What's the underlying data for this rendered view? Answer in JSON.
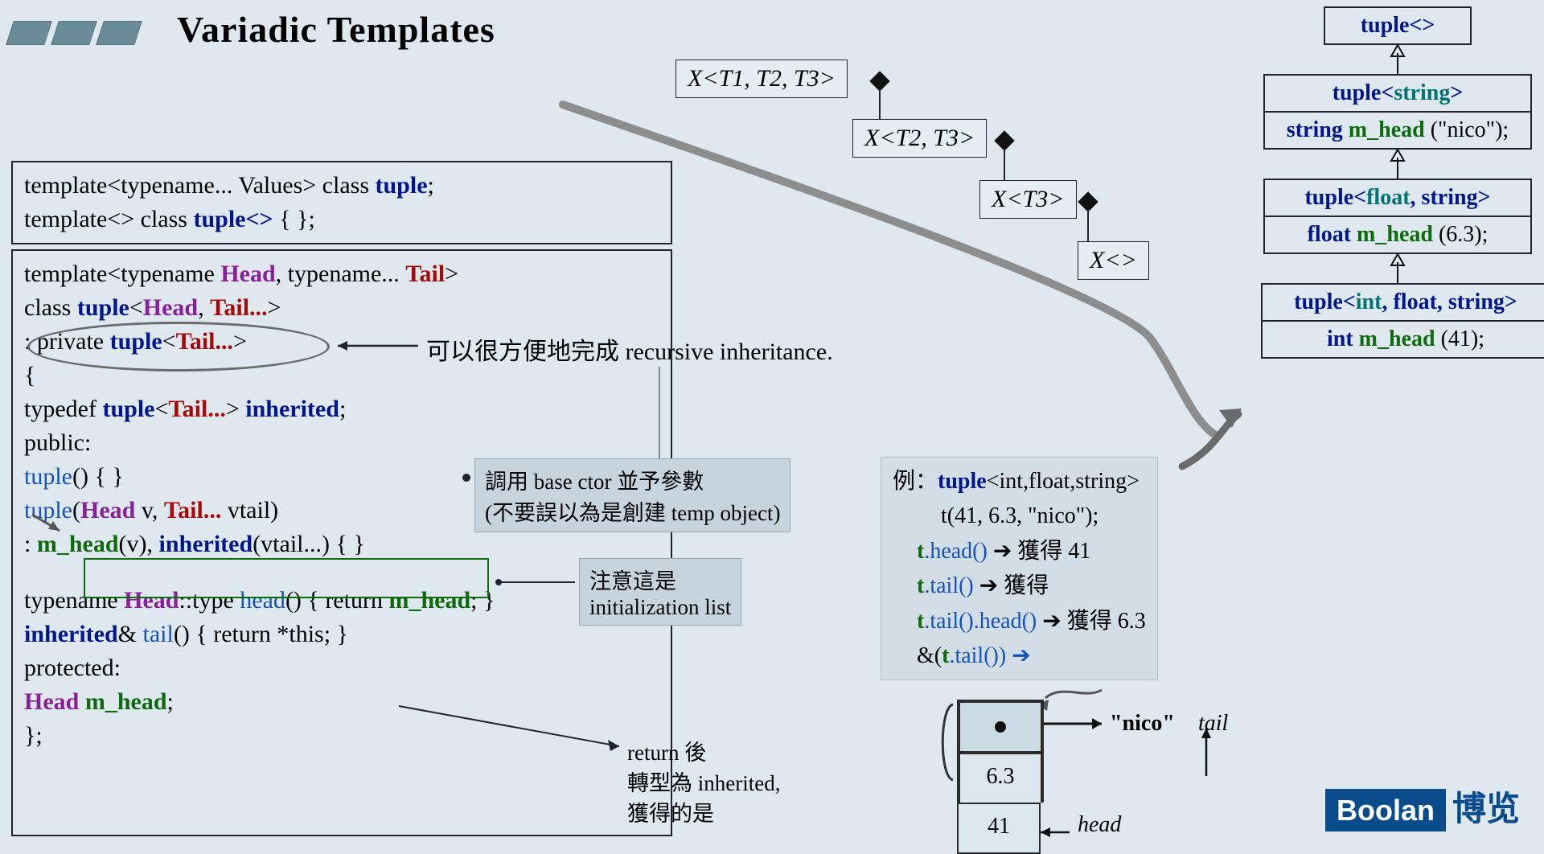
{
  "title": "Variadic Templates",
  "decl_box": {
    "line1_a": "template<typename... Values> class ",
    "line1_b": "tuple",
    "line1_c": ";",
    "line2_a": "template<> class ",
    "line2_b": "tuple<>",
    "line2_c": " { };"
  },
  "main_code": {
    "l1a": "template<typename ",
    "l1b": "Head",
    "l1c": ", typename... ",
    "l1d": "Tail",
    "l1e": ">",
    "l2a": "class ",
    "l2b": "tuple",
    "l2c": "<",
    "l2d": "Head",
    "l2e": ", ",
    "l2f": "Tail...",
    "l2g": ">",
    "l3a": "  : private ",
    "l3b": "tuple",
    "l3c": "<",
    "l3d": "Tail...",
    "l3e": ">",
    "l4": "{",
    "l5a": "    typedef ",
    "l5b": "tuple",
    "l5c": "<",
    "l5d": "Tail...",
    "l5e": "> ",
    "l5f": "inherited",
    "l5g": ";",
    "l6": "public:",
    "l7a": "    tuple",
    "l7b": "() { }",
    "l8a": "    tuple",
    "l8b": "(",
    "l8c": "Head",
    "l8d": " v, ",
    "l8e": "Tail...",
    "l8f": " vtail)",
    "l9a": "      : ",
    "l9b": "m_head",
    "l9c": "(v), ",
    "l9d": "inherited",
    "l9e": "(vtail...) { }",
    "l10a": "    typename ",
    "l10b": "Head",
    "l10c": "::type ",
    "l10d": "head",
    "l10e": "() { return ",
    "l10f": "m_head",
    "l10g": "; }",
    "l11a": "    ",
    "l11b": "inherited",
    "l11c": "& ",
    "l11d": "tail",
    "l11e": "() { return *this; }",
    "l12": "protected:",
    "l13a": "    ",
    "l13b": "Head",
    "l13c": " ",
    "l13d": "m_head",
    "l13e": ";",
    "l14": "};"
  },
  "note_recursive": "可以很方便地完成 recursive inheritance.",
  "note_ctor": {
    "l1": "調用 base ctor 並予參數",
    "l2": "(不要誤以為是創建 temp object)"
  },
  "note_init": {
    "l1": "注意這是",
    "l2": "initialization list"
  },
  "note_return": {
    "l1": "return 後",
    "l2": "轉型為 inherited,",
    "l3": "獲得的是"
  },
  "x_boxes": {
    "x1": "X<T1, T2, T3>",
    "x2": "X<T2, T3>",
    "x3": "X<T3>",
    "x4": "X<>"
  },
  "hierarchy": {
    "h1": "tuple<>",
    "h2a": "tuple<",
    "h2b": "string",
    "h2c": ">",
    "h2v": "string ",
    "h2vn": "m_head",
    "h2vt": " (\"nico\");",
    "h3a": "tuple<",
    "h3b": "float",
    "h3c": ", string>",
    "h3v": "float ",
    "h3vn": "m_head",
    "h3vt": " (6.3);",
    "h4a": "tuple<",
    "h4b": "int",
    "h4c": ", float, string>",
    "h4v": "int ",
    "h4vn": "m_head",
    "h4vt": " (41);"
  },
  "example": {
    "e0": "例：",
    "e0a": "tuple",
    "e0b": "<int,float,string>",
    "e1": "t(41, 6.3, \"nico\");",
    "e2a": "t",
    "e2b": ".head()",
    "e2c": " ➔ 獲得 41",
    "e3a": "t",
    "e3b": ".tail()",
    "e3c": " ➔ 獲得",
    "e4a": "t",
    "e4b": ".tail()",
    "e4c": ".head()",
    "e4d": " ➔ 獲得 6.3",
    "e5a": "&(",
    "e5b": "t",
    "e5c": ".tail()) ➔"
  },
  "stack": {
    "s1": "\"nico\"",
    "s2": "6.3",
    "s3": "41"
  },
  "labels": {
    "head": "head",
    "tail": "tail"
  },
  "logo": {
    "en": "Boolan",
    "cn": "博览"
  }
}
